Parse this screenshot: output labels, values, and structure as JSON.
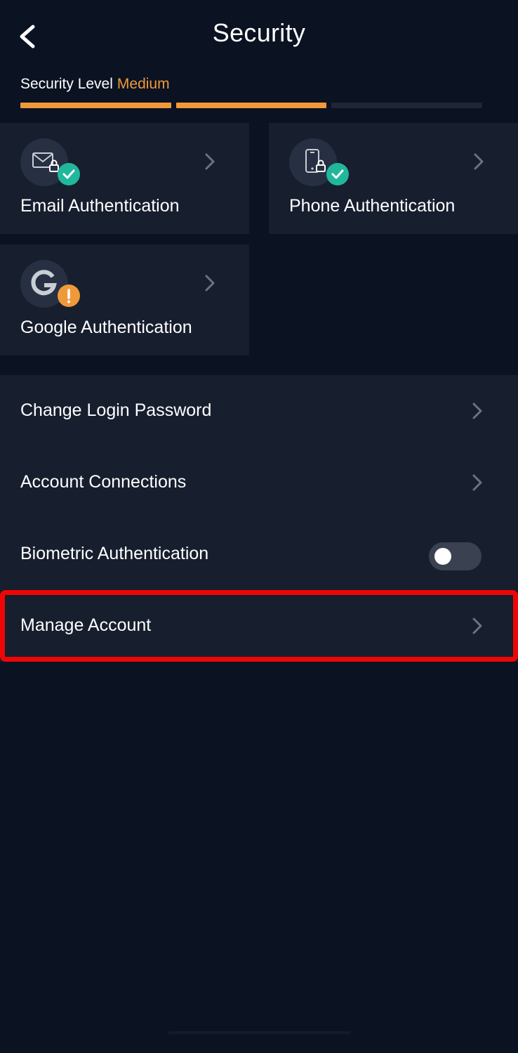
{
  "header": {
    "title": "Security",
    "back_icon": "chevron-left-icon"
  },
  "security_level": {
    "label": "Security Level",
    "value": "Medium",
    "filled_segments": 2,
    "total_segments": 3,
    "accent": "#f0993a"
  },
  "auth_cards": [
    {
      "label": "Email Authentication",
      "icon": "email-lock-icon",
      "status": "verified",
      "status_icon": "check-icon"
    },
    {
      "label": "Phone Authentication",
      "icon": "phone-lock-icon",
      "status": "verified",
      "status_icon": "check-icon"
    },
    {
      "label": "Google Authentication",
      "icon": "google-icon",
      "status": "warning",
      "status_icon": "exclamation-icon"
    }
  ],
  "settings": {
    "change_password": {
      "label": "Change Login Password"
    },
    "account_connections": {
      "label": "Account Connections"
    },
    "biometric": {
      "label": "Biometric Authentication",
      "enabled": false
    },
    "manage_account": {
      "label": "Manage Account"
    }
  },
  "colors": {
    "background": "#0b1222",
    "card": "#171e2e",
    "verified": "#21b79d",
    "warning": "#f0993a",
    "highlight": "#ee0606"
  }
}
